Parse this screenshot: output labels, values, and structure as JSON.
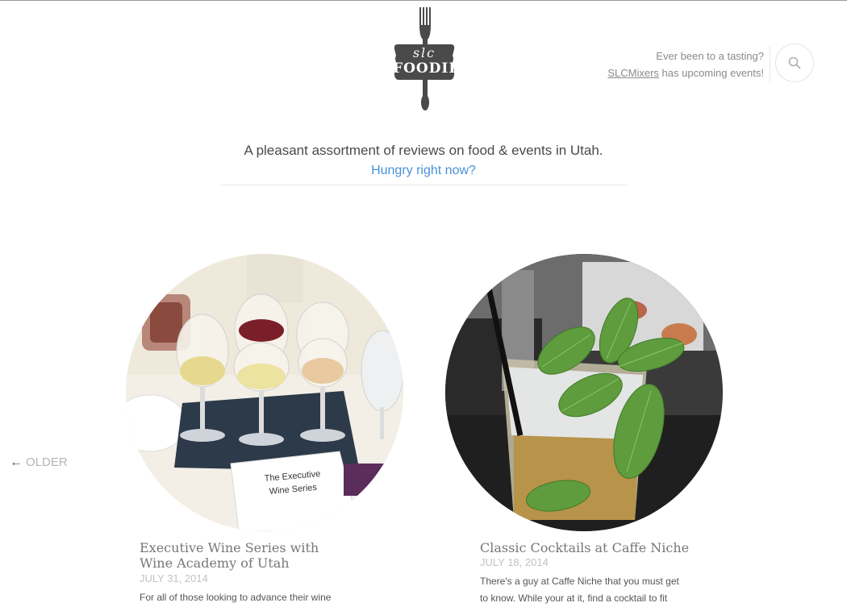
{
  "site": {
    "logo_top": "slc",
    "logo_main": "FOODIE",
    "tagline": "A pleasant assortment of reviews on food & events in Utah.",
    "hungry_link": "Hungry right now?"
  },
  "promo": {
    "line1": "Ever been to a tasting?",
    "link": "SLCMixers",
    "line2_rest": " has upcoming events!"
  },
  "search": {
    "icon": "search-icon"
  },
  "nav": {
    "older_arrow": "←",
    "older_label": "OLDER"
  },
  "posts": [
    {
      "title": "Executive Wine Series with Wine Academy of Utah",
      "date": "JULY 31, 2014",
      "excerpt": "For all of those looking to advance their wine",
      "image": "wine-glasses-photo",
      "card_line1": "The Executive",
      "card_line2": "Wine Series"
    },
    {
      "title": "Classic Cocktails at Caffe Niche",
      "date": "JULY 18, 2014",
      "excerpt": "There's a guy at Caffe Niche that you must get to know.  While your at it, find a cocktail to fit",
      "image": "mint-cocktail-photo"
    }
  ],
  "colors": {
    "link_blue": "#4a90d9",
    "logo_dark": "#4a4a4a",
    "date_gray": "#c2c2c2"
  }
}
